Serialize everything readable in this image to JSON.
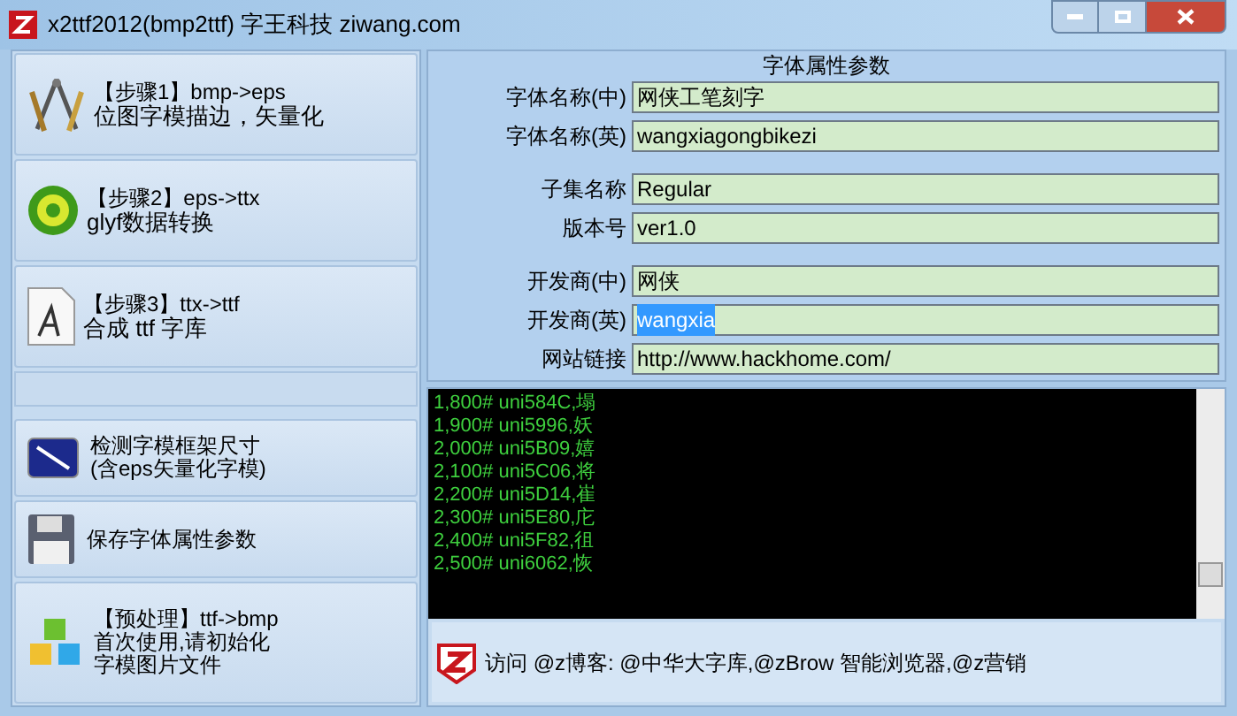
{
  "window": {
    "title": "x2ttf2012(bmp2ttf) 字王科技 ziwang.com"
  },
  "steps": [
    {
      "kind": "compass",
      "line1": "【步骤1】bmp->eps",
      "line2": "位图字模描边，矢量化"
    },
    {
      "kind": "disc",
      "line1": "【步骤2】eps->ttx",
      "line2": "glyf数据转换"
    },
    {
      "kind": "document",
      "line1": "【步骤3】ttx->ttf",
      "line2": "合成 ttf 字库"
    }
  ],
  "tools": [
    {
      "kind": "resize",
      "lines": [
        "检测字模框架尺寸",
        "(含eps矢量化字模)"
      ]
    },
    {
      "kind": "save",
      "lines": [
        "保存字体属性参数"
      ]
    },
    {
      "kind": "cubes",
      "lines": [
        "【预处理】ttf->bmp",
        "首次使用,请初始化",
        "字模图片文件"
      ]
    }
  ],
  "properties": {
    "title": "字体属性参数",
    "groups": [
      [
        {
          "label": "字体名称(中)",
          "value": "网侠工笔刻字",
          "highlighted": false
        },
        {
          "label": "字体名称(英)",
          "value": "wangxiagongbikezi",
          "highlighted": false
        }
      ],
      [
        {
          "label": "子集名称",
          "value": "Regular",
          "highlighted": false
        },
        {
          "label": "版本号",
          "value": "ver1.0",
          "highlighted": false
        }
      ],
      [
        {
          "label": "开发商(中)",
          "value": "网侠",
          "highlighted": false
        },
        {
          "label": "开发商(英)",
          "value": "wangxia",
          "highlighted": true
        },
        {
          "label": "网站链接",
          "value": "http://www.hackhome.com/",
          "highlighted": false
        }
      ]
    ]
  },
  "log": [
    "1,800# uni584C,塌",
    "1,900# uni5996,妖",
    "2,000# uni5B09,嬉",
    "2,100# uni5C06,将",
    "2,200# uni5D14,崔",
    "2,300# uni5E80,庀",
    "2,400# uni5F82,徂",
    "2,500# uni6062,恢"
  ],
  "footer": {
    "text": "访问 @z博客: @中华大字库,@zBrow 智能浏览器,@z营销"
  }
}
